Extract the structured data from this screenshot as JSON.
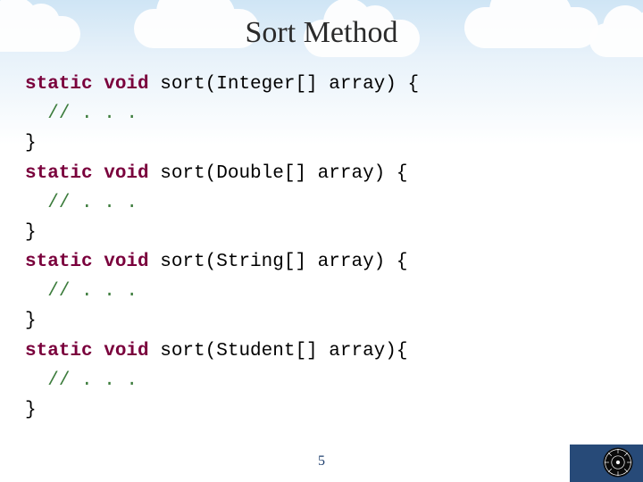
{
  "slide": {
    "title": "Sort Method",
    "page_number": "5"
  },
  "code": {
    "l1a": "static void",
    "l1b": " sort(Integer[] array) {",
    "l2": "// . . .",
    "l3": "}",
    "l4a": "static void",
    "l4b": " sort(Double[] array) {",
    "l5": "// . . .",
    "l6": "}",
    "l7a": "static void",
    "l7b": " sort(String[] array) {",
    "l8": "// . . .",
    "l9": "}",
    "l10a": "static void",
    "l10b": " sort(Student[] array){",
    "l11": "// . . .",
    "l12": "}"
  }
}
